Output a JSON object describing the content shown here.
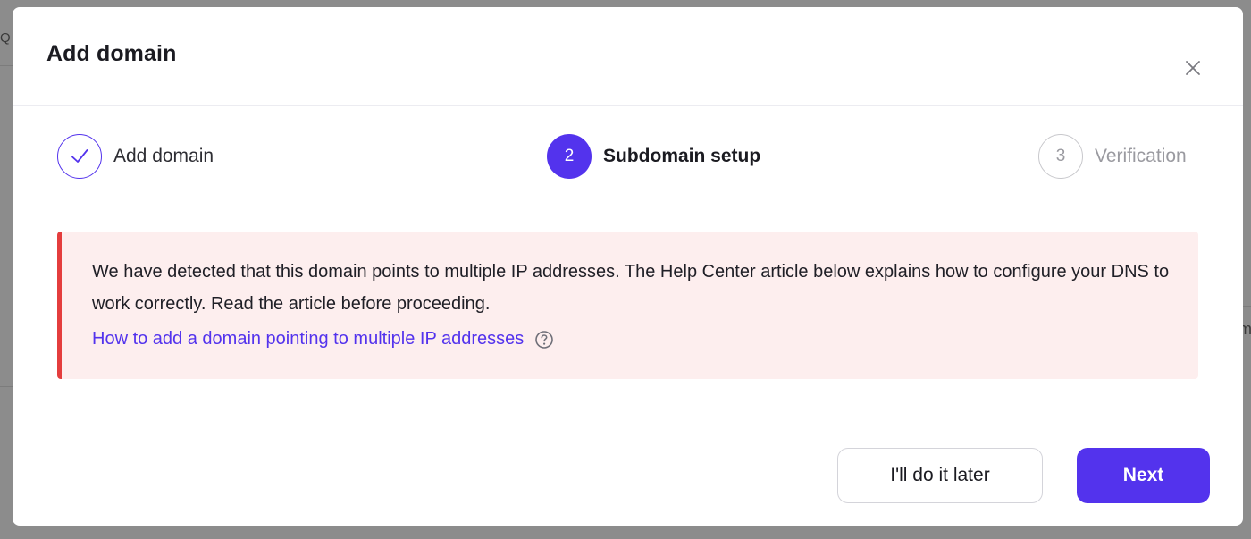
{
  "modal": {
    "title": "Add domain",
    "close_label": "Close"
  },
  "stepper": {
    "steps": [
      {
        "number": "1",
        "label": "Add domain",
        "state": "done",
        "icon": "check-icon"
      },
      {
        "number": "2",
        "label": "Subdomain setup",
        "state": "active"
      },
      {
        "number": "3",
        "label": "Verification",
        "state": "pending"
      }
    ]
  },
  "alert": {
    "type": "error",
    "message": "We have detected that this domain points to multiple IP addresses. The Help Center article below explains how to configure your DNS to work correctly. Read the article before proceeding.",
    "link_text": "How to add a domain pointing to multiple IP addresses",
    "help_icon": "question-circle-icon"
  },
  "footer": {
    "secondary_label": "I'll do it later",
    "primary_label": "Next"
  },
  "colors": {
    "accent": "#5333ed",
    "alert_border": "#e43d3d",
    "alert_bg": "#fdeeee"
  }
}
